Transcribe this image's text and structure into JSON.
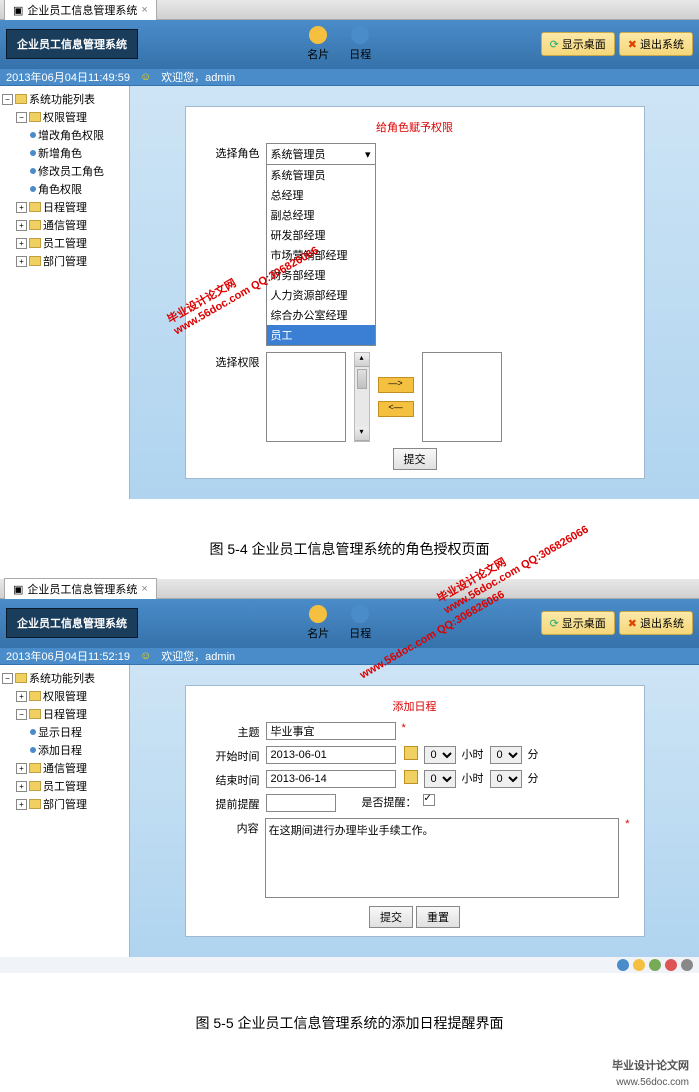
{
  "screenshot1": {
    "tab": {
      "title": "企业员工信息管理系统",
      "close": "×"
    },
    "logo": "企业员工信息管理系统",
    "header_icons": {
      "card": "名片",
      "schedule": "日程"
    },
    "header_btns": {
      "desktop": "显示桌面",
      "exit": "退出系统"
    },
    "status": {
      "time": "2013年06月04日11:49:59",
      "welcome": "欢迎您，admin"
    },
    "sidebar": {
      "root": "系统功能列表",
      "perm_mgmt": "权限管理",
      "perm_children": [
        "增改角色权限",
        "新增角色",
        "修改员工角色",
        "角色权限"
      ],
      "other": [
        "日程管理",
        "通信管理",
        "员工管理",
        "部门管理"
      ]
    },
    "panel": {
      "title": "给角色赋予权限",
      "role_label": "选择角色",
      "perm_label": "选择权限",
      "selected_role": "系统管理员",
      "role_options": [
        "系统管理员",
        "总经理",
        "副总经理",
        "研发部经理",
        "市场营销部经理",
        "财务部经理",
        "人力资源部经理",
        "综合办公室经理",
        "员工"
      ],
      "submit": "提交"
    }
  },
  "caption1": "图 5-4  企业员工信息管理系统的角色授权页面",
  "watermarks": {
    "text1": "毕业设计论文网",
    "text2": "www.56doc.com  QQ:306826066"
  },
  "screenshot2": {
    "tab": {
      "title": "企业员工信息管理系统",
      "close": "×"
    },
    "logo": "企业员工信息管理系统",
    "header_icons": {
      "card": "名片",
      "schedule": "日程"
    },
    "header_btns": {
      "desktop": "显示桌面",
      "exit": "退出系统"
    },
    "status": {
      "time": "2013年06月04日11:52:19",
      "welcome": "欢迎您，admin"
    },
    "sidebar": {
      "root": "系统功能列表",
      "perm_mgmt": "权限管理",
      "sched_mgmt": "日程管理",
      "sched_children": [
        "显示日程",
        "添加日程"
      ],
      "other": [
        "通信管理",
        "员工管理",
        "部门管理"
      ]
    },
    "panel": {
      "title": "添加日程",
      "subject_label": "主题",
      "subject_value": "毕业事宜",
      "start_label": "开始时间",
      "start_value": "2013-06-01",
      "end_label": "结束时间",
      "end_value": "2013-06-14",
      "hour_val": "00",
      "hour_unit": "小时",
      "min_val": "00",
      "min_unit": "分",
      "remind_label": "提前提醒",
      "is_remind_label": "是否提醒：",
      "content_label": "内容",
      "content_value": "在这期间进行办理毕业手续工作。",
      "submit": "提交",
      "reset": "重置"
    }
  },
  "caption2": "图 5-5  企业员工信息管理系统的添加日程提醒界面",
  "footer": {
    "brand": "毕业设计论文网",
    "url": "www.56doc.com"
  }
}
